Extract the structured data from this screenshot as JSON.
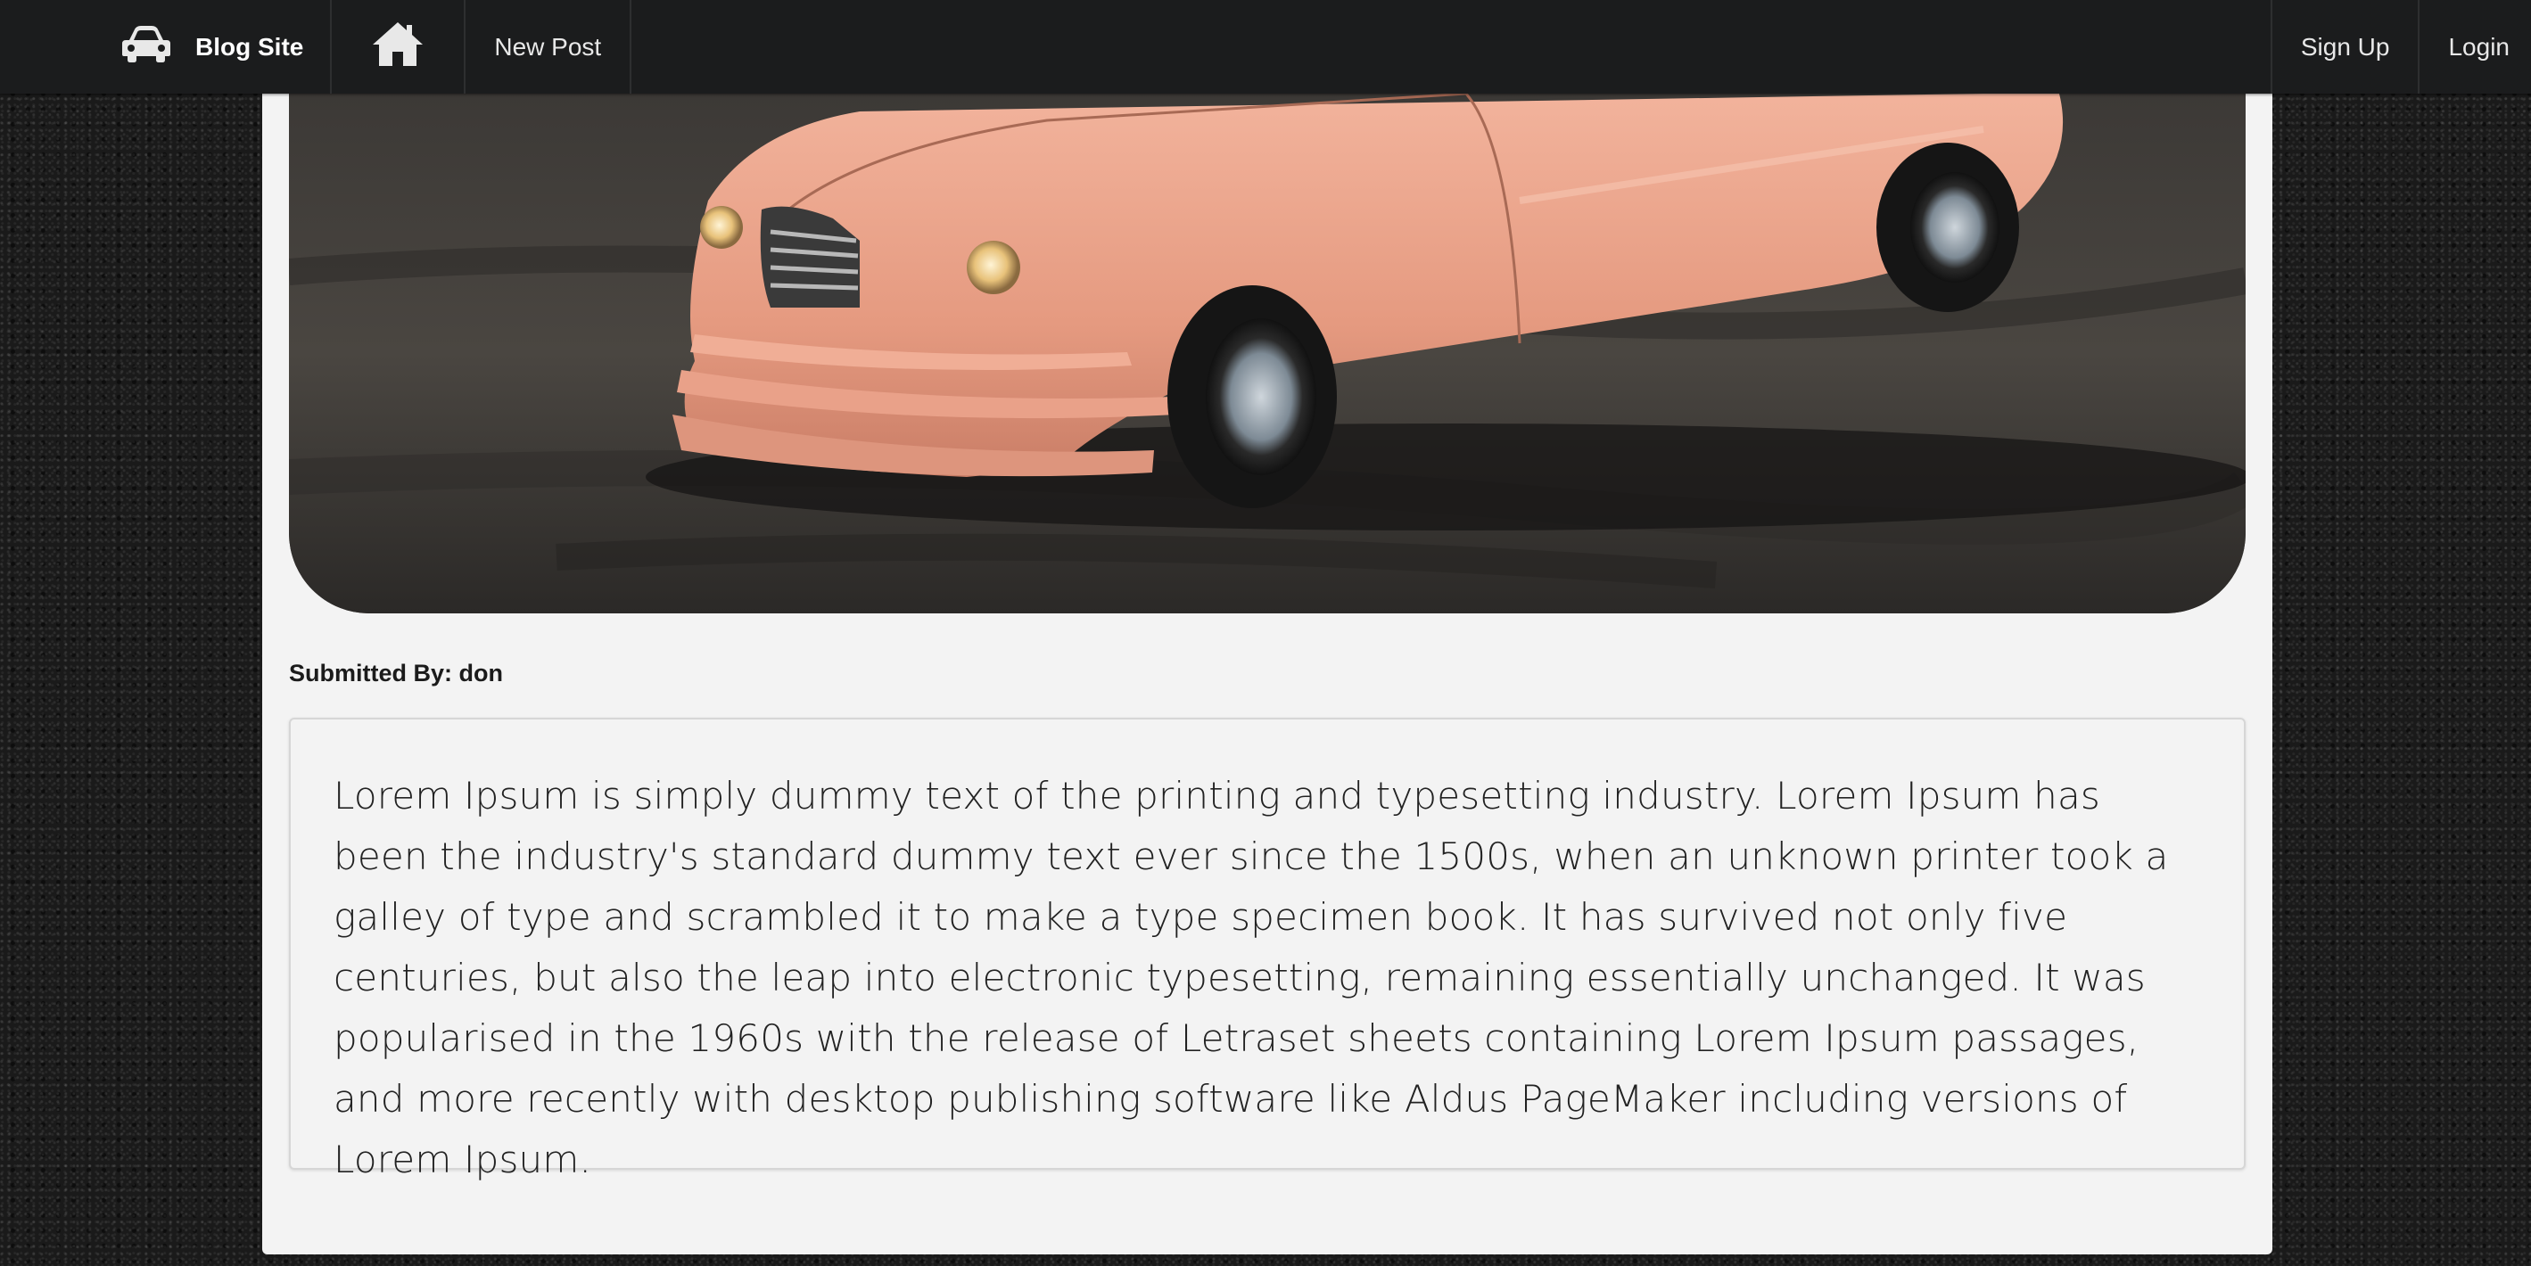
{
  "navbar": {
    "brand_label": "Blog Site",
    "brand_icon": "car-icon",
    "home_icon": "home-icon",
    "new_post_label": "New Post",
    "sign_up_label": "Sign Up",
    "login_label": "Login"
  },
  "post": {
    "image": "pink-vintage-car-photo",
    "submitted_by": "Submitted By: don",
    "body": "Lorem Ipsum is simply dummy text of the printing and typesetting industry. Lorem Ipsum has been the industry's standard dummy text ever since the 1500s, when an unknown printer took a galley of type and scrambled it to make a type specimen book. It has survived not only five centuries, but also the leap into electronic typesetting, remaining essentially unchanged. It was popularised in the 1960s with the release of Letraset sheets containing Lorem Ipsum passages, and more recently with desktop publishing software like Aldus PageMaker including versions of Lorem Ipsum."
  },
  "colors": {
    "navbar_bg": "#1b1c1d",
    "card_bg": "#f3f3f3",
    "car_body": "#e8a088"
  }
}
